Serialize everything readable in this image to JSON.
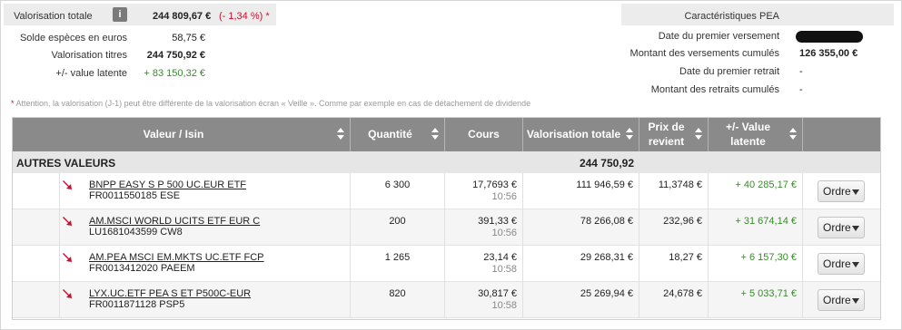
{
  "summary": {
    "total_label": "Valorisation totale",
    "total_value": "244 809,67 €",
    "total_variation": "(- 1,34 %) *",
    "rows": [
      {
        "label": "Solde espèces en euros",
        "value": "58,75 €"
      },
      {
        "label": "Valorisation titres",
        "value": "244 750,92 €"
      },
      {
        "label": "+/- value latente",
        "value": "+ 83 150,32 €"
      }
    ]
  },
  "characteristics": {
    "title": "Caractéristiques PEA",
    "rows": [
      {
        "label": "Date du premier versement",
        "value": ""
      },
      {
        "label": "Montant des versements cumulés",
        "value": "126 355,00 €"
      },
      {
        "label": "Date du premier retrait",
        "value": "-"
      },
      {
        "label": "Montant des retraits cumulés",
        "value": "-"
      }
    ]
  },
  "note": {
    "asterisk": "*",
    "text": " Attention, la valorisation (J-1) peut être différente de la valorisation écran « Veille ». Comme par exemple en cas de détachement de dividende"
  },
  "table": {
    "headers": {
      "valeur": "Valeur / Isin",
      "quantite": "Quantité",
      "cours": "Cours",
      "valorisation": "Valorisation totale",
      "prix": "Prix de revient",
      "plus_value": "+/- Value latente"
    },
    "group": {
      "name": "AUTRES VALEURS",
      "total": "244 750,92"
    },
    "rows": [
      {
        "name": "BNPP EASY S P 500 UC.EUR ETF",
        "isin": "FR0011550185 ESE",
        "quantite": "6 300",
        "cours": "17,7693 €",
        "time": "10:56",
        "valorisation": "111 946,59 €",
        "prix": "11,3748 €",
        "plus_value": "+ 40 285,17 €",
        "ordre": "Ordre"
      },
      {
        "name": "AM.MSCI WORLD UCITS ETF EUR C",
        "isin": "LU1681043599 CW8",
        "quantite": "200",
        "cours": "391,33 €",
        "time": "10:56",
        "valorisation": "78 266,08 €",
        "prix": "232,96 €",
        "plus_value": "+ 31 674,14 €",
        "ordre": "Ordre"
      },
      {
        "name": "AM.PEA MSCI EM.MKTS UC.ETF FCP",
        "isin": "FR0013412020 PAEEM",
        "quantite": "1 265",
        "cours": "23,14 €",
        "time": "10:58",
        "valorisation": "29 268,31 €",
        "prix": "18,27 €",
        "plus_value": "+ 6 157,30 €",
        "ordre": "Ordre"
      },
      {
        "name": "LYX.UC.ETF PEA S ET P500C-EUR",
        "isin": "FR0011871128 PSP5",
        "quantite": "820",
        "cours": "30,817 €",
        "time": "10:58",
        "valorisation": "25 269,94 €",
        "prix": "24,678 €",
        "plus_value": "+ 5 033,71 €",
        "ordre": "Ordre"
      }
    ]
  },
  "colors": {
    "negative": "#c8102e",
    "positive": "#3a8a2e",
    "header_bg": "#8a8a8a"
  }
}
